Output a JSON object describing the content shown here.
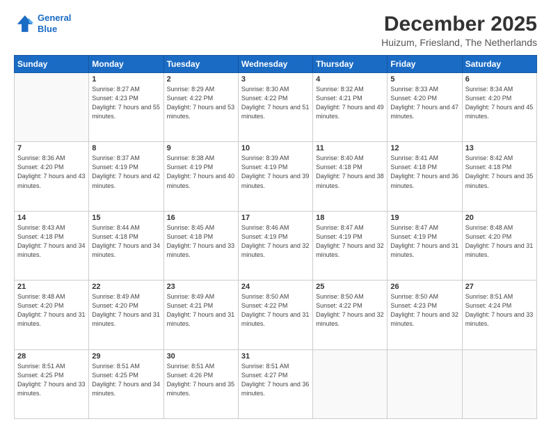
{
  "logo": {
    "line1": "General",
    "line2": "Blue"
  },
  "header": {
    "title": "December 2025",
    "subtitle": "Huizum, Friesland, The Netherlands"
  },
  "days": [
    "Sunday",
    "Monday",
    "Tuesday",
    "Wednesday",
    "Thursday",
    "Friday",
    "Saturday"
  ],
  "weeks": [
    [
      {
        "day": "",
        "sunrise": "",
        "sunset": "",
        "daylight": ""
      },
      {
        "day": "1",
        "sunrise": "Sunrise: 8:27 AM",
        "sunset": "Sunset: 4:23 PM",
        "daylight": "Daylight: 7 hours and 55 minutes."
      },
      {
        "day": "2",
        "sunrise": "Sunrise: 8:29 AM",
        "sunset": "Sunset: 4:22 PM",
        "daylight": "Daylight: 7 hours and 53 minutes."
      },
      {
        "day": "3",
        "sunrise": "Sunrise: 8:30 AM",
        "sunset": "Sunset: 4:22 PM",
        "daylight": "Daylight: 7 hours and 51 minutes."
      },
      {
        "day": "4",
        "sunrise": "Sunrise: 8:32 AM",
        "sunset": "Sunset: 4:21 PM",
        "daylight": "Daylight: 7 hours and 49 minutes."
      },
      {
        "day": "5",
        "sunrise": "Sunrise: 8:33 AM",
        "sunset": "Sunset: 4:20 PM",
        "daylight": "Daylight: 7 hours and 47 minutes."
      },
      {
        "day": "6",
        "sunrise": "Sunrise: 8:34 AM",
        "sunset": "Sunset: 4:20 PM",
        "daylight": "Daylight: 7 hours and 45 minutes."
      }
    ],
    [
      {
        "day": "7",
        "sunrise": "Sunrise: 8:36 AM",
        "sunset": "Sunset: 4:20 PM",
        "daylight": "Daylight: 7 hours and 43 minutes."
      },
      {
        "day": "8",
        "sunrise": "Sunrise: 8:37 AM",
        "sunset": "Sunset: 4:19 PM",
        "daylight": "Daylight: 7 hours and 42 minutes."
      },
      {
        "day": "9",
        "sunrise": "Sunrise: 8:38 AM",
        "sunset": "Sunset: 4:19 PM",
        "daylight": "Daylight: 7 hours and 40 minutes."
      },
      {
        "day": "10",
        "sunrise": "Sunrise: 8:39 AM",
        "sunset": "Sunset: 4:19 PM",
        "daylight": "Daylight: 7 hours and 39 minutes."
      },
      {
        "day": "11",
        "sunrise": "Sunrise: 8:40 AM",
        "sunset": "Sunset: 4:18 PM",
        "daylight": "Daylight: 7 hours and 38 minutes."
      },
      {
        "day": "12",
        "sunrise": "Sunrise: 8:41 AM",
        "sunset": "Sunset: 4:18 PM",
        "daylight": "Daylight: 7 hours and 36 minutes."
      },
      {
        "day": "13",
        "sunrise": "Sunrise: 8:42 AM",
        "sunset": "Sunset: 4:18 PM",
        "daylight": "Daylight: 7 hours and 35 minutes."
      }
    ],
    [
      {
        "day": "14",
        "sunrise": "Sunrise: 8:43 AM",
        "sunset": "Sunset: 4:18 PM",
        "daylight": "Daylight: 7 hours and 34 minutes."
      },
      {
        "day": "15",
        "sunrise": "Sunrise: 8:44 AM",
        "sunset": "Sunset: 4:18 PM",
        "daylight": "Daylight: 7 hours and 34 minutes."
      },
      {
        "day": "16",
        "sunrise": "Sunrise: 8:45 AM",
        "sunset": "Sunset: 4:18 PM",
        "daylight": "Daylight: 7 hours and 33 minutes."
      },
      {
        "day": "17",
        "sunrise": "Sunrise: 8:46 AM",
        "sunset": "Sunset: 4:19 PM",
        "daylight": "Daylight: 7 hours and 32 minutes."
      },
      {
        "day": "18",
        "sunrise": "Sunrise: 8:47 AM",
        "sunset": "Sunset: 4:19 PM",
        "daylight": "Daylight: 7 hours and 32 minutes."
      },
      {
        "day": "19",
        "sunrise": "Sunrise: 8:47 AM",
        "sunset": "Sunset: 4:19 PM",
        "daylight": "Daylight: 7 hours and 31 minutes."
      },
      {
        "day": "20",
        "sunrise": "Sunrise: 8:48 AM",
        "sunset": "Sunset: 4:20 PM",
        "daylight": "Daylight: 7 hours and 31 minutes."
      }
    ],
    [
      {
        "day": "21",
        "sunrise": "Sunrise: 8:48 AM",
        "sunset": "Sunset: 4:20 PM",
        "daylight": "Daylight: 7 hours and 31 minutes."
      },
      {
        "day": "22",
        "sunrise": "Sunrise: 8:49 AM",
        "sunset": "Sunset: 4:20 PM",
        "daylight": "Daylight: 7 hours and 31 minutes."
      },
      {
        "day": "23",
        "sunrise": "Sunrise: 8:49 AM",
        "sunset": "Sunset: 4:21 PM",
        "daylight": "Daylight: 7 hours and 31 minutes."
      },
      {
        "day": "24",
        "sunrise": "Sunrise: 8:50 AM",
        "sunset": "Sunset: 4:22 PM",
        "daylight": "Daylight: 7 hours and 31 minutes."
      },
      {
        "day": "25",
        "sunrise": "Sunrise: 8:50 AM",
        "sunset": "Sunset: 4:22 PM",
        "daylight": "Daylight: 7 hours and 32 minutes."
      },
      {
        "day": "26",
        "sunrise": "Sunrise: 8:50 AM",
        "sunset": "Sunset: 4:23 PM",
        "daylight": "Daylight: 7 hours and 32 minutes."
      },
      {
        "day": "27",
        "sunrise": "Sunrise: 8:51 AM",
        "sunset": "Sunset: 4:24 PM",
        "daylight": "Daylight: 7 hours and 33 minutes."
      }
    ],
    [
      {
        "day": "28",
        "sunrise": "Sunrise: 8:51 AM",
        "sunset": "Sunset: 4:25 PM",
        "daylight": "Daylight: 7 hours and 33 minutes."
      },
      {
        "day": "29",
        "sunrise": "Sunrise: 8:51 AM",
        "sunset": "Sunset: 4:25 PM",
        "daylight": "Daylight: 7 hours and 34 minutes."
      },
      {
        "day": "30",
        "sunrise": "Sunrise: 8:51 AM",
        "sunset": "Sunset: 4:26 PM",
        "daylight": "Daylight: 7 hours and 35 minutes."
      },
      {
        "day": "31",
        "sunrise": "Sunrise: 8:51 AM",
        "sunset": "Sunset: 4:27 PM",
        "daylight": "Daylight: 7 hours and 36 minutes."
      },
      {
        "day": "",
        "sunrise": "",
        "sunset": "",
        "daylight": ""
      },
      {
        "day": "",
        "sunrise": "",
        "sunset": "",
        "daylight": ""
      },
      {
        "day": "",
        "sunrise": "",
        "sunset": "",
        "daylight": ""
      }
    ]
  ]
}
